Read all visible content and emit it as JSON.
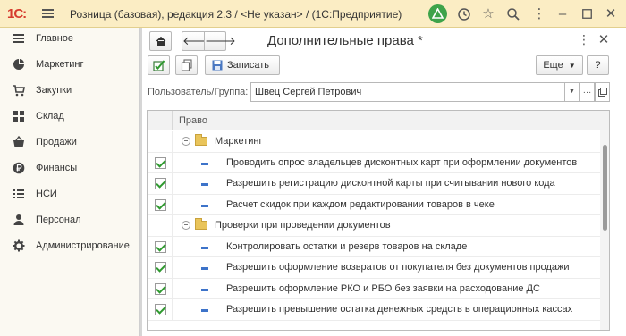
{
  "titlebar": {
    "logo": "1С:",
    "app_title": "Розница (базовая), редакция 2.3 / <Не указан> / (1С:Предприятие)"
  },
  "sidebar": {
    "items": [
      {
        "label": "Главное",
        "icon": "menu-lines-icon"
      },
      {
        "label": "Маркетинг",
        "icon": "pie-chart-icon"
      },
      {
        "label": "Закупки",
        "icon": "cart-icon"
      },
      {
        "label": "Склад",
        "icon": "grid-icon"
      },
      {
        "label": "Продажи",
        "icon": "basket-icon"
      },
      {
        "label": "Финансы",
        "icon": "ruble-coin-icon"
      },
      {
        "label": "НСИ",
        "icon": "list-icon"
      },
      {
        "label": "Персонал",
        "icon": "person-icon"
      },
      {
        "label": "Администрирование",
        "icon": "gear-icon"
      }
    ]
  },
  "form": {
    "title": "Дополнительные права *",
    "save_label": "Записать",
    "more_label": "Еще",
    "help_label": "?",
    "user_field": {
      "label": "Пользователь/Группа:",
      "value": "Швец Сергей Петрович"
    },
    "tree": {
      "column_header": "Право",
      "rows": [
        {
          "type": "group",
          "text": "Маркетинг",
          "checked": false
        },
        {
          "type": "item",
          "text": "Проводить опрос владельцев дисконтных карт при оформлении документов",
          "checked": true
        },
        {
          "type": "item",
          "text": "Разрешить регистрацию дисконтной карты при считывании нового кода",
          "checked": true
        },
        {
          "type": "item",
          "text": "Расчет скидок при каждом редактировании товаров в чеке",
          "checked": true
        },
        {
          "type": "group",
          "text": "Проверки при проведении документов",
          "checked": false
        },
        {
          "type": "item",
          "text": "Контролировать остатки и резерв товаров на складе",
          "checked": true
        },
        {
          "type": "item",
          "text": "Разрешить оформление возвратов от покупателя без документов продажи",
          "checked": true
        },
        {
          "type": "item",
          "text": "Разрешить оформление РКО и РБО без заявки на расходование ДС",
          "checked": true
        },
        {
          "type": "item",
          "text": "Разрешить превышение остатка денежных средств в операционных кассах",
          "checked": true
        }
      ]
    }
  },
  "colors": {
    "titlebar_bg": "#fbedc4",
    "sidebar_bg": "#fbf9f2",
    "accent_green": "#3ea34a",
    "logo_red": "#d63b2e",
    "check_green": "#2f9a2f"
  }
}
